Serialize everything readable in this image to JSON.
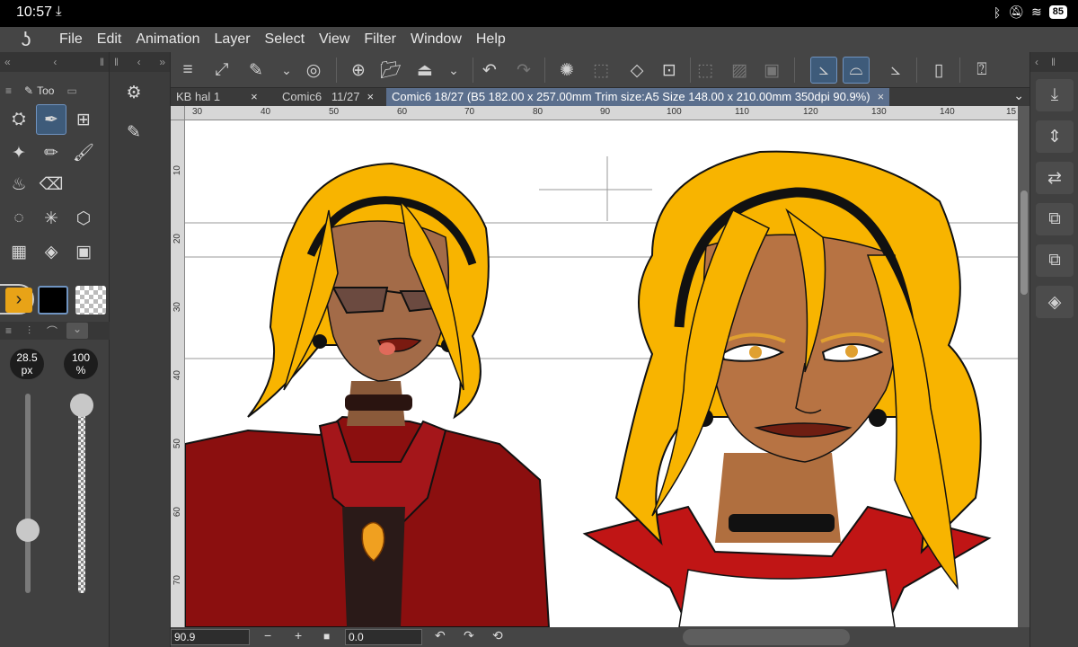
{
  "status": {
    "time": "10:57",
    "download_icon": "download-icon",
    "battery": "85"
  },
  "menu": {
    "logo_icon": "app-logo-icon",
    "items": [
      "File",
      "Edit",
      "Animation",
      "Layer",
      "Select",
      "View",
      "Filter",
      "Window",
      "Help"
    ]
  },
  "left_panel": {
    "tab_label": "Too",
    "brush_size": "28.5\npx",
    "brush_size_text": "28.5",
    "brush_size_unit": "px",
    "opacity_text": "100",
    "opacity_unit": "%",
    "brush_size_level": 0.29,
    "opacity_level": 1.0,
    "main_color": "#000000",
    "sub_color": "#e8a317"
  },
  "tabs": [
    {
      "label": "KB hal 1",
      "close": "×"
    },
    {
      "label": "Comic6   11/27",
      "close": "×"
    },
    {
      "label": "Comic6 18/27 (B5 182.00 x 257.00mm Trim size:A5 Size 148.00 x 210.00mm 350dpi 90.9%)",
      "close": "×"
    }
  ],
  "ruler": {
    "h_labels": [
      "30",
      "40",
      "50",
      "60",
      "70",
      "80",
      "90",
      "100",
      "110",
      "120",
      "130",
      "140",
      "15"
    ],
    "v_labels": [
      "10",
      "20",
      "30",
      "40",
      "50",
      "60",
      "70"
    ]
  },
  "bottom": {
    "zoom": "90.9",
    "minus": "−",
    "plus": "+",
    "angle": "0.0"
  }
}
